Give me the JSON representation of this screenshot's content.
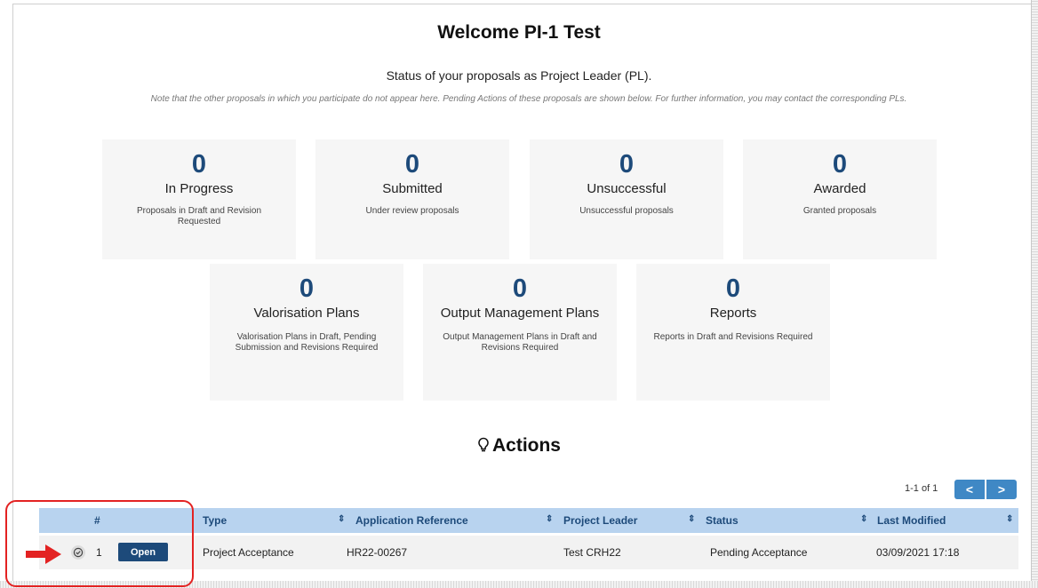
{
  "header": {
    "title": "Welcome PI-1 Test",
    "subtitle": "Status of your proposals as Project Leader (PL).",
    "note": "Note that the other proposals in which you participate do not appear here. Pending Actions of these proposals are shown below. For further information, you may contact the corresponding PLs."
  },
  "cards": [
    {
      "count": "0",
      "label": "In Progress",
      "desc": "Proposals in Draft and Revision Requested"
    },
    {
      "count": "0",
      "label": "Submitted",
      "desc": "Under review proposals"
    },
    {
      "count": "0",
      "label": "Unsuccessful",
      "desc": "Unsuccessful proposals"
    },
    {
      "count": "0",
      "label": "Awarded",
      "desc": "Granted proposals"
    },
    {
      "count": "0",
      "label": "Valorisation Plans",
      "desc": "Valorisation Plans in Draft, Pending Submission and Revisions Required"
    },
    {
      "count": "0",
      "label": "Output Management Plans",
      "desc": "Output Management Plans in Draft and Revisions Required"
    },
    {
      "count": "0",
      "label": "Reports",
      "desc": "Reports in Draft and Revisions Required"
    }
  ],
  "actions": {
    "title": "Actions",
    "icon": "lightbulb-icon",
    "pager": {
      "text": "1-1 of 1",
      "prev": "<",
      "next": ">"
    },
    "columns": [
      "#",
      "Type",
      "Application Reference",
      "Project Leader",
      "Status",
      "Last Modified"
    ],
    "rows": [
      {
        "index": "1",
        "open_label": "Open",
        "type": "Project Acceptance",
        "reference": "HR22-00267",
        "leader": "Test CRH22",
        "status": "Pending Acceptance",
        "modified": "03/09/2021 17:18"
      }
    ]
  },
  "colors": {
    "accent": "#1d4a7a",
    "header_bg": "#b8d3ef",
    "pager_bg": "#3f88c5",
    "highlight": "#e32222"
  }
}
